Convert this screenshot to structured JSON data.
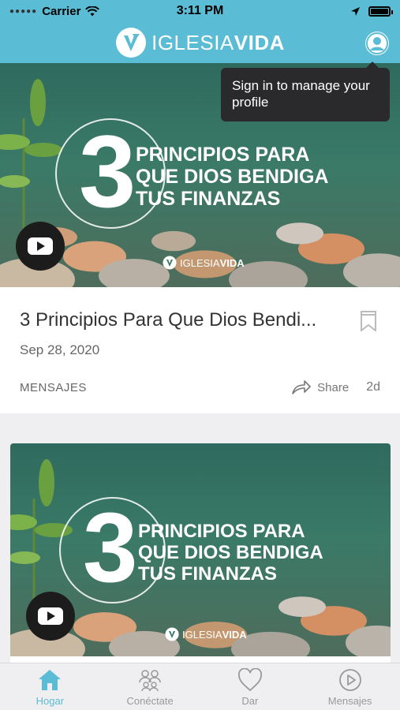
{
  "status_bar": {
    "carrier": "Carrier",
    "time": "3:11 PM"
  },
  "header": {
    "brand_light": "IGLESIA",
    "brand_bold": "VIDA",
    "profile_icon": "user-icon"
  },
  "tooltip": {
    "text": "Sign in to manage your profile"
  },
  "thumbnail": {
    "number": "3",
    "line1": "PRINCIPIOS PARA",
    "line2": "QUE DIOS BENDIGA",
    "line3": "TUS FINANZAS",
    "watermark_light": "IGLESIA",
    "watermark_bold": "VIDA"
  },
  "cards": [
    {
      "title": "3 Principios Para Que Dios Bendi...",
      "date": "Sep 28, 2020",
      "category": "MENSAJES",
      "share_label": "Share",
      "age": "2d"
    }
  ],
  "tabs": [
    {
      "label": "Hogar",
      "icon": "home-icon",
      "active": true
    },
    {
      "label": "Conéctate",
      "icon": "people-icon",
      "active": false
    },
    {
      "label": "Dar",
      "icon": "heart-icon",
      "active": false
    },
    {
      "label": "Mensajes",
      "icon": "play-icon",
      "active": false
    }
  ],
  "colors": {
    "accent": "#5bbcd5",
    "tooltip_bg": "#2a2a2c"
  }
}
